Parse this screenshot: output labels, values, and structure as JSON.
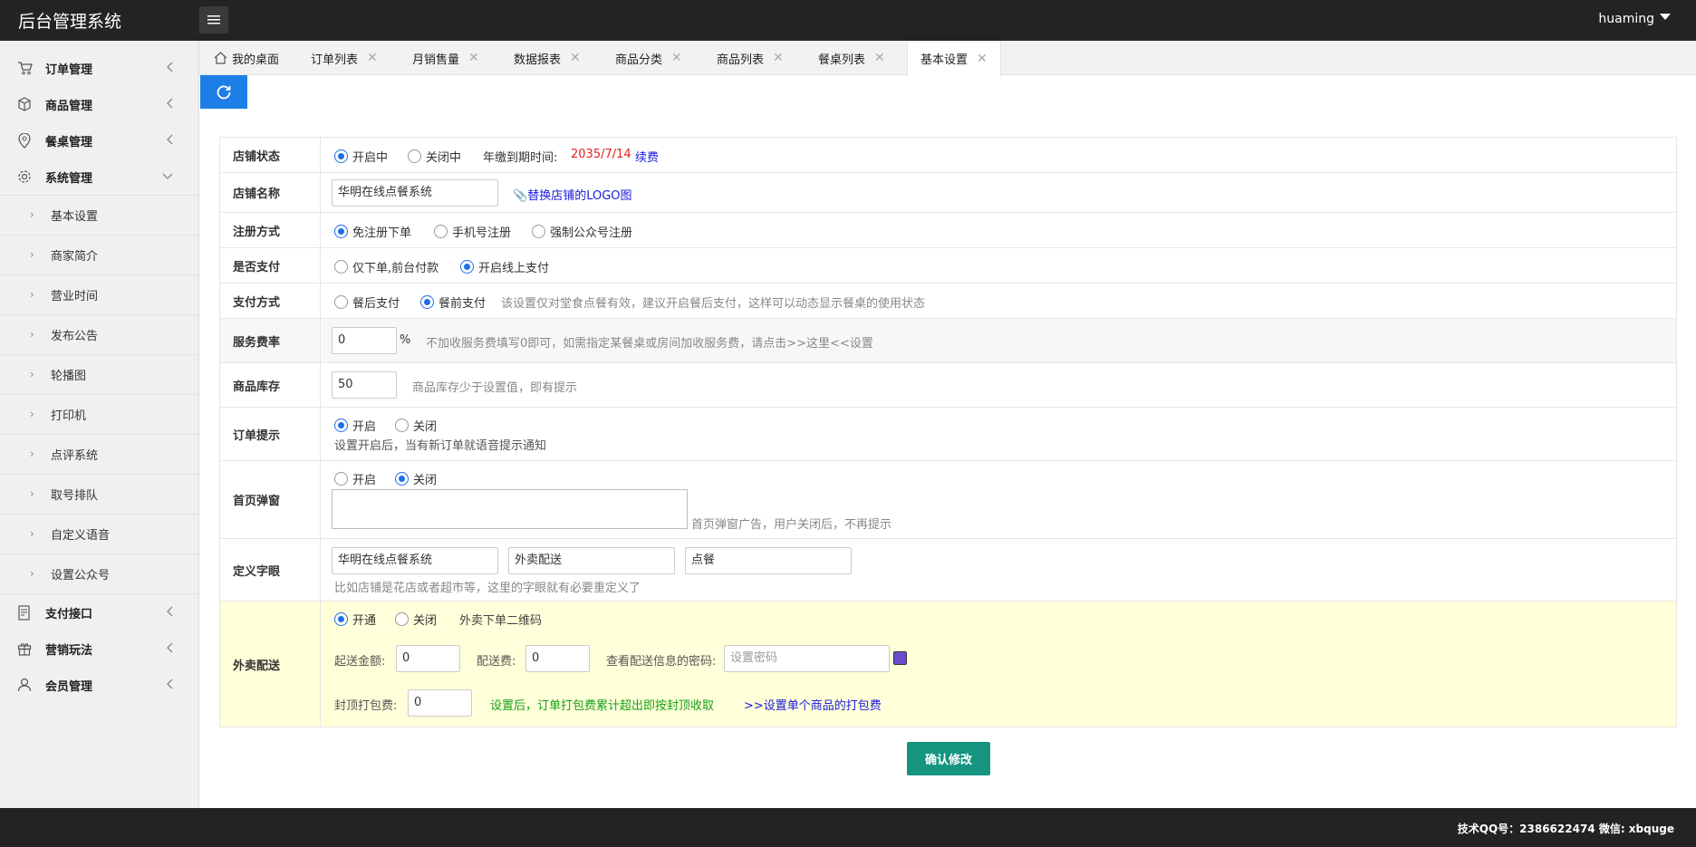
{
  "app": {
    "title": "后台管理系统",
    "user": "huaming"
  },
  "sidebar": {
    "groups": [
      {
        "label": "订单管理",
        "icon": "cart-icon"
      },
      {
        "label": "商品管理",
        "icon": "box-icon"
      },
      {
        "label": "餐桌管理",
        "icon": "location-pin-icon"
      },
      {
        "label": "系统管理",
        "icon": "gear-icon"
      }
    ],
    "sub_items": [
      "基本设置",
      "商家简介",
      "营业时间",
      "发布公告",
      "轮播图",
      "打印机",
      "点评系统",
      "取号排队",
      "自定义语音",
      "设置公众号"
    ],
    "bottom_groups": [
      {
        "label": "支付接口",
        "icon": "payment-icon"
      },
      {
        "label": "营销玩法",
        "icon": "gift-icon"
      },
      {
        "label": "会员管理",
        "icon": "user-icon"
      }
    ]
  },
  "tabs": [
    "我的桌面",
    "订单列表",
    "月销售量",
    "数据报表",
    "商品分类",
    "商品列表",
    "餐桌列表",
    "基本设置"
  ],
  "form": {
    "shop_status": {
      "label": "店铺状态",
      "opt_open": "开启中",
      "opt_closed": "关闭中",
      "expiry_label": "年缴到期时间:",
      "expiry_date": "2035/7/14",
      "renew": "续费"
    },
    "shop_name": {
      "label": "店铺名称",
      "value": "华明在线点餐系统",
      "logo_link": "替换店铺的LOGO图"
    },
    "register": {
      "label": "注册方式",
      "opt1": "免注册下单",
      "opt2": "手机号注册",
      "opt3": "强制公众号注册"
    },
    "pay_enable": {
      "label": "是否支付",
      "opt1": "仅下单,前台付款",
      "opt2": "开启线上支付"
    },
    "pay_mode": {
      "label": "支付方式",
      "opt1": "餐后支付",
      "opt2": "餐前支付",
      "hint": "该设置仅对堂食点餐有效，建议开启餐后支付，这样可以动态显示餐桌的使用状态"
    },
    "service_rate": {
      "label": "服务费率",
      "value": "0",
      "unit": "%",
      "hint": "不加收服务费填写0即可，如需指定某餐桌或房间加收服务费，请点击>>这里<<设置"
    },
    "stock": {
      "label": "商品库存",
      "value": "50",
      "hint": "商品库存少于设置值，即有提示"
    },
    "order_alert": {
      "label": "订单提示",
      "opt_on": "开启",
      "opt_off": "关闭",
      "hint": "设置开启后，当有新订单就语音提示通知"
    },
    "popup": {
      "label": "首页弹窗",
      "opt_on": "开启",
      "opt_off": "关闭",
      "hint": "首页弹窗广告，用户关闭后，不再提示"
    },
    "custom_words": {
      "label": "定义字眼",
      "v1": "华明在线点餐系统",
      "v2": "外卖配送",
      "v3": "点餐",
      "hint": "比如店铺是花店或者超市等，这里的字眼就有必要重定义了"
    },
    "delivery": {
      "label": "外卖配送",
      "opt_on": "开通",
      "opt_off": "关闭",
      "qr_label": "外卖下单二维码",
      "min_label": "起送金额:",
      "min_value": "0",
      "fee_label": "配送费:",
      "fee_value": "0",
      "pwd_label": "查看配送信息的密码:",
      "pwd_placeholder": "设置密码",
      "pack_label": "封顶打包费:",
      "pack_value": "0",
      "pack_hint": "设置后，订单打包费累计超出即按封顶收取",
      "pack_link": ">>设置单个商品的打包费"
    }
  },
  "submit_label": "确认修改",
  "footer": "技术QQ号：2386622474 微信: xbquge",
  "colors": {
    "accent": "#1e7ee8",
    "submit": "#159480",
    "header": "#232323"
  }
}
